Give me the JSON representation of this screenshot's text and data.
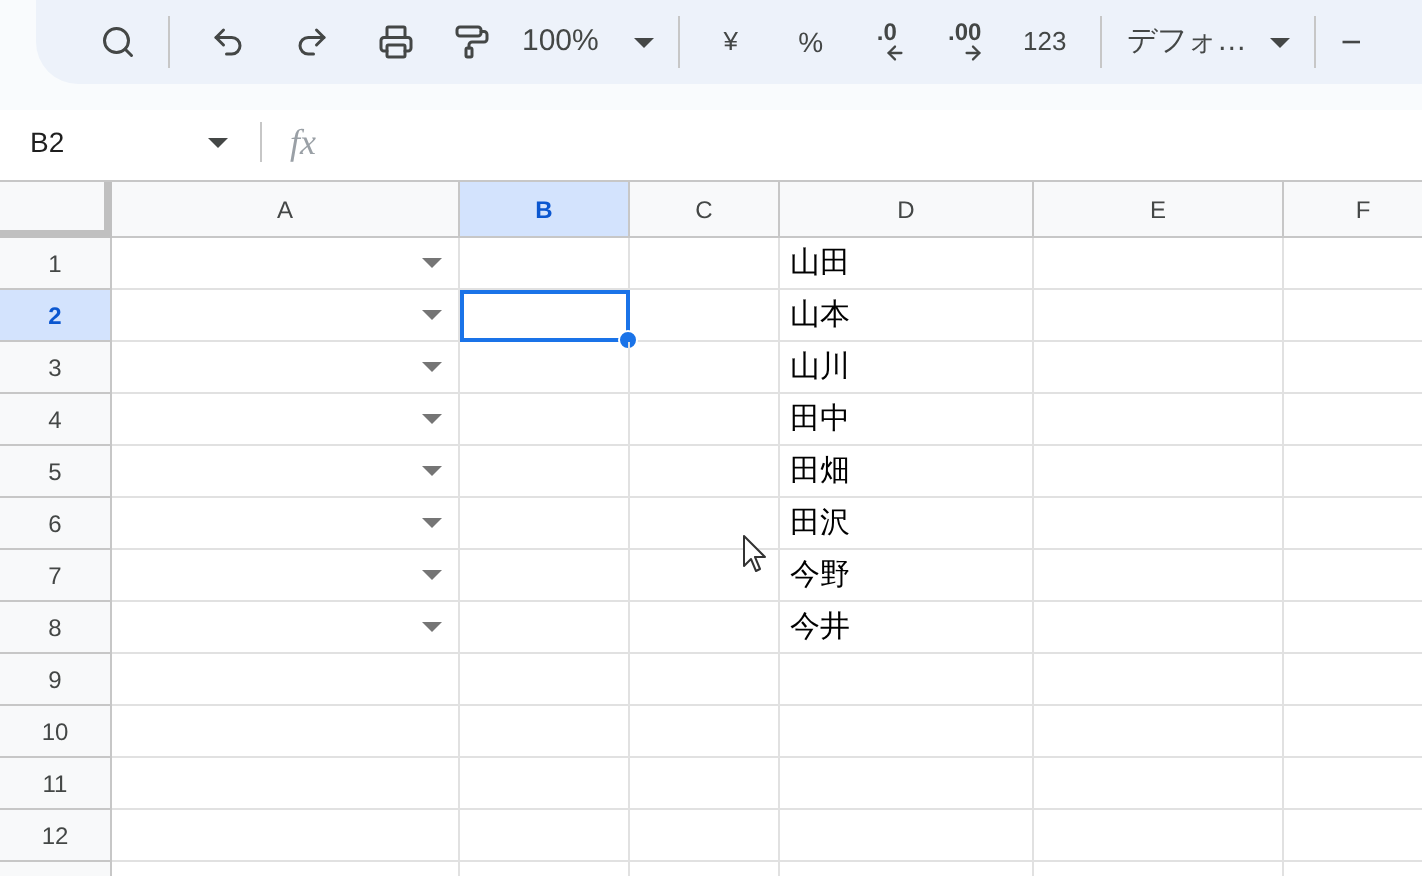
{
  "toolbar": {
    "zoom": "100%",
    "currency": "¥",
    "percent": "%",
    "decrease_decimals": ".0",
    "increase_decimals": ".00",
    "number_format": "123",
    "font": "デフォ…",
    "font_size_minus": "−"
  },
  "formula_bar": {
    "name_box": "B2",
    "fx": "fx"
  },
  "columns": [
    {
      "label": "A",
      "selected": false
    },
    {
      "label": "B",
      "selected": true
    },
    {
      "label": "C",
      "selected": false
    },
    {
      "label": "D",
      "selected": false
    },
    {
      "label": "E",
      "selected": false
    },
    {
      "label": "F",
      "selected": false
    }
  ],
  "rows": [
    {
      "label": "1",
      "selected": false,
      "a_dropdown": true,
      "b_active": false,
      "d": "山田"
    },
    {
      "label": "2",
      "selected": true,
      "a_dropdown": true,
      "b_active": true,
      "d": "山本"
    },
    {
      "label": "3",
      "selected": false,
      "a_dropdown": true,
      "b_active": false,
      "d": "山川"
    },
    {
      "label": "4",
      "selected": false,
      "a_dropdown": true,
      "b_active": false,
      "d": "田中"
    },
    {
      "label": "5",
      "selected": false,
      "a_dropdown": true,
      "b_active": false,
      "d": "田畑"
    },
    {
      "label": "6",
      "selected": false,
      "a_dropdown": true,
      "b_active": false,
      "d": "田沢"
    },
    {
      "label": "7",
      "selected": false,
      "a_dropdown": true,
      "b_active": false,
      "d": "今野"
    },
    {
      "label": "8",
      "selected": false,
      "a_dropdown": true,
      "b_active": false,
      "d": "今井"
    },
    {
      "label": "9",
      "selected": false,
      "a_dropdown": false,
      "b_active": false
    },
    {
      "label": "10",
      "selected": false,
      "a_dropdown": false,
      "b_active": false
    },
    {
      "label": "11",
      "selected": false,
      "a_dropdown": false,
      "b_active": false
    },
    {
      "label": "12",
      "selected": false,
      "a_dropdown": false,
      "b_active": false
    }
  ]
}
